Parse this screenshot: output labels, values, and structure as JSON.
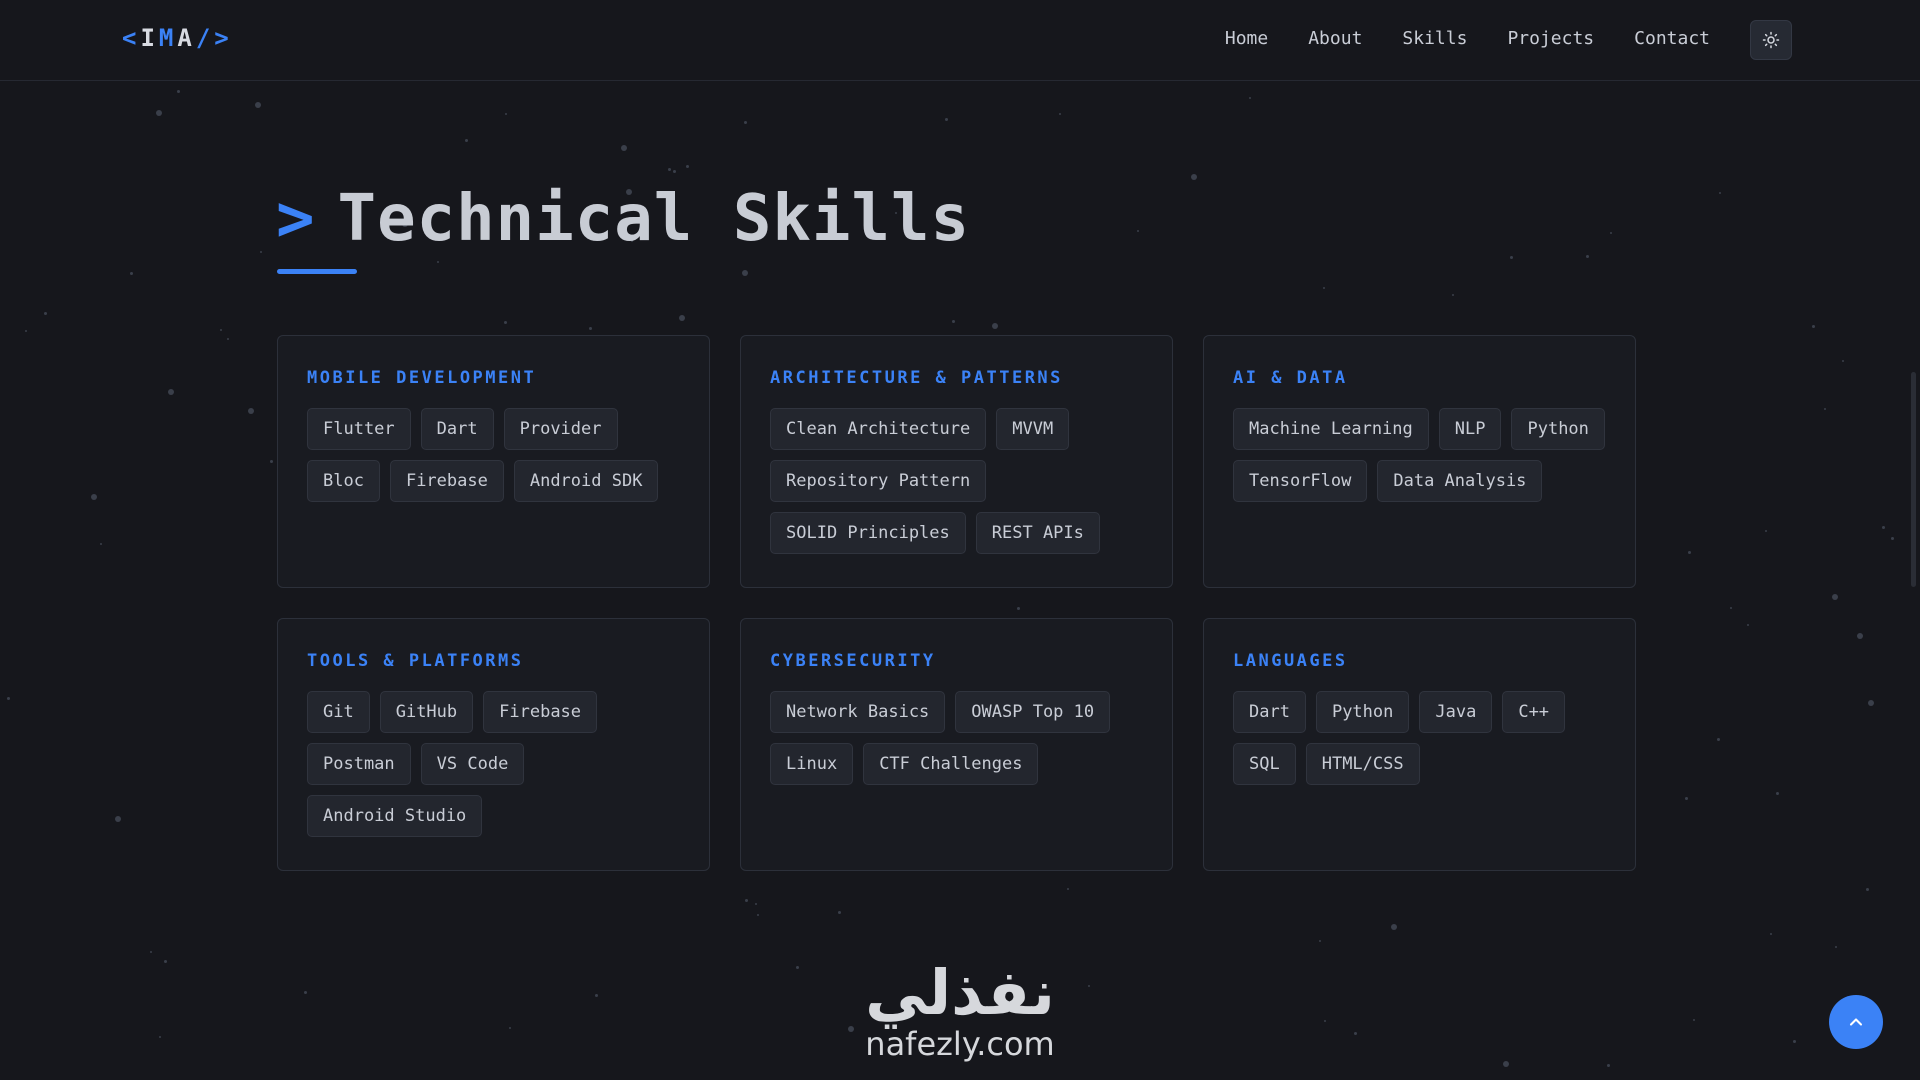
{
  "header": {
    "logo": {
      "open": "<",
      "i": "I",
      "m": "M",
      "a": "A",
      "close": "/>"
    },
    "nav": [
      "Home",
      "About",
      "Skills",
      "Projects",
      "Contact"
    ],
    "theme_icon": "sun-icon"
  },
  "section": {
    "prompt": ">",
    "title": "Technical Skills"
  },
  "cards": [
    {
      "title": "MOBILE DEVELOPMENT",
      "tags": [
        "Flutter",
        "Dart",
        "Provider",
        "Bloc",
        "Firebase",
        "Android SDK"
      ]
    },
    {
      "title": "ARCHITECTURE & PATTERNS",
      "tags": [
        "Clean Architecture",
        "MVVM",
        "Repository Pattern",
        "SOLID Principles",
        "REST APIs"
      ]
    },
    {
      "title": "AI & DATA",
      "tags": [
        "Machine Learning",
        "NLP",
        "Python",
        "TensorFlow",
        "Data Analysis"
      ]
    },
    {
      "title": "TOOLS & PLATFORMS",
      "tags": [
        "Git",
        "GitHub",
        "Firebase",
        "Postman",
        "VS Code",
        "Android Studio"
      ]
    },
    {
      "title": "CYBERSECURITY",
      "tags": [
        "Network Basics",
        "OWASP Top 10",
        "Linux",
        "CTF Challenges"
      ]
    },
    {
      "title": "LANGUAGES",
      "tags": [
        "Dart",
        "Python",
        "Java",
        "C++",
        "SQL",
        "HTML/CSS"
      ]
    }
  ],
  "brand": {
    "arabic": "نفذلي",
    "latin": "nafezly.com"
  },
  "scroll_top_icon": "chevron-up-icon",
  "colors": {
    "accent": "#3b82f6",
    "background": "#16171c",
    "card": "#191b21"
  }
}
